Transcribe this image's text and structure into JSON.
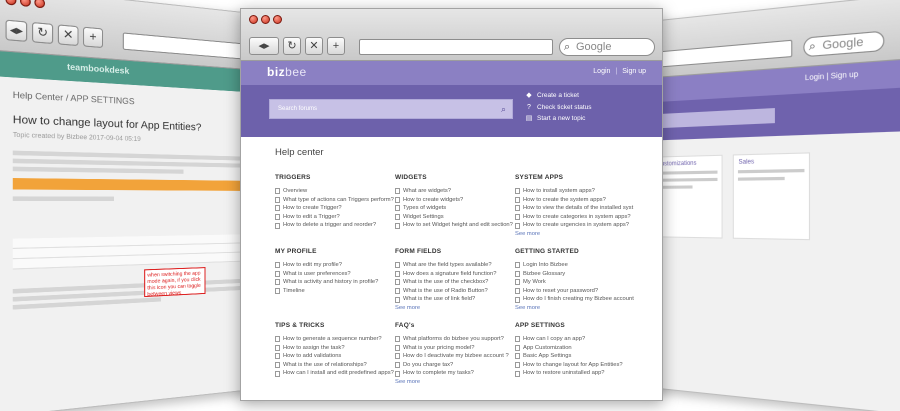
{
  "browser": {
    "search_placeholder": "Google"
  },
  "left_window": {
    "logo": "teambookdesk",
    "breadcrumb": "Help Center / APP SETTINGS",
    "article_title": "How to change layout for App Entities?",
    "article_meta": "Topic created by Bizbee 2017-09-04 05:19",
    "callout": "when switching the app mode again, if you click this icon you can toggle between views"
  },
  "right_window": {
    "links": "Login | Sign up",
    "cards": [
      "Customizations",
      "Sales"
    ]
  },
  "header": {
    "brand_part1": "biz",
    "brand_part2": "bee",
    "login": "Login",
    "separator": "|",
    "signup": "Sign up"
  },
  "search": {
    "placeholder": "Search forums"
  },
  "actions": [
    {
      "label": "Create a ticket",
      "icon": "tag-icon"
    },
    {
      "label": "Check ticket status",
      "icon": "question-icon"
    },
    {
      "label": "Start a new topic",
      "icon": "document-icon"
    }
  ],
  "help_center": {
    "title": "Help center",
    "see_more": "See more",
    "sections": [
      {
        "title": "TRIGGERS",
        "items": [
          "Overview",
          "What type of actions can Triggers perform?",
          "How to create Trigger?",
          "How to edit a Trigger?",
          "How to delete a trigger and reorder?"
        ],
        "see_more": false
      },
      {
        "title": "WIDGETS",
        "items": [
          "What are widgets?",
          "How to create widgets?",
          "Types of widgets",
          "Widget Settings",
          "How to set Widget height and edit section?"
        ],
        "see_more": false
      },
      {
        "title": "SYSTEM APPS",
        "items": [
          "How to install system apps?",
          "How to create the system apps?",
          "How to view the details of the installed syst",
          "How to create categories in system apps?",
          "How to create urgencies in system apps?"
        ],
        "see_more": true
      },
      {
        "title": "MY PROFILE",
        "items": [
          "How to edit my profile?",
          "What is user preferences?",
          "What is activity and history in profile?",
          "Timeline"
        ],
        "see_more": false
      },
      {
        "title": "FORM FIELDS",
        "items": [
          "What are the field types available?",
          "How does a signature field function?",
          "What is the use of the checkbox?",
          "What is the use of Radio Button?",
          "What is the use of link field?"
        ],
        "see_more": true
      },
      {
        "title": "GETTING STARTED",
        "items": [
          "Login Into Bizbee",
          "Bizbee Glossary",
          "My Work",
          "How to reset your password?",
          "How do I finish creating my Bizbee account"
        ],
        "see_more": true
      },
      {
        "title": "TIPS & TRICKS",
        "items": [
          "How to generate a sequence number?",
          "How to assign the task?",
          "How to add validations",
          "What is the use of relationships?",
          "How can I install and edit predefined apps?"
        ],
        "see_more": false
      },
      {
        "title": "FAQ's",
        "items": [
          "What platforms do bizbee you support?",
          "What is your pricing model?",
          "How do I deactivate my bizbee account ?",
          "Do you charge tax?",
          "How to complete my tasks?"
        ],
        "see_more": true
      },
      {
        "title": "APP SETTINGS",
        "items": [
          "How can I copy an app?",
          "App Customization",
          "Basic App Settings",
          "How to change layout for App Entities?",
          "How to restore uninstalled app?"
        ],
        "see_more": false
      }
    ]
  },
  "colors": {
    "topbar": "#8b80c3",
    "band": "#6d61ab",
    "left_accent": "#4f9b8a",
    "link": "#5a74b8"
  }
}
